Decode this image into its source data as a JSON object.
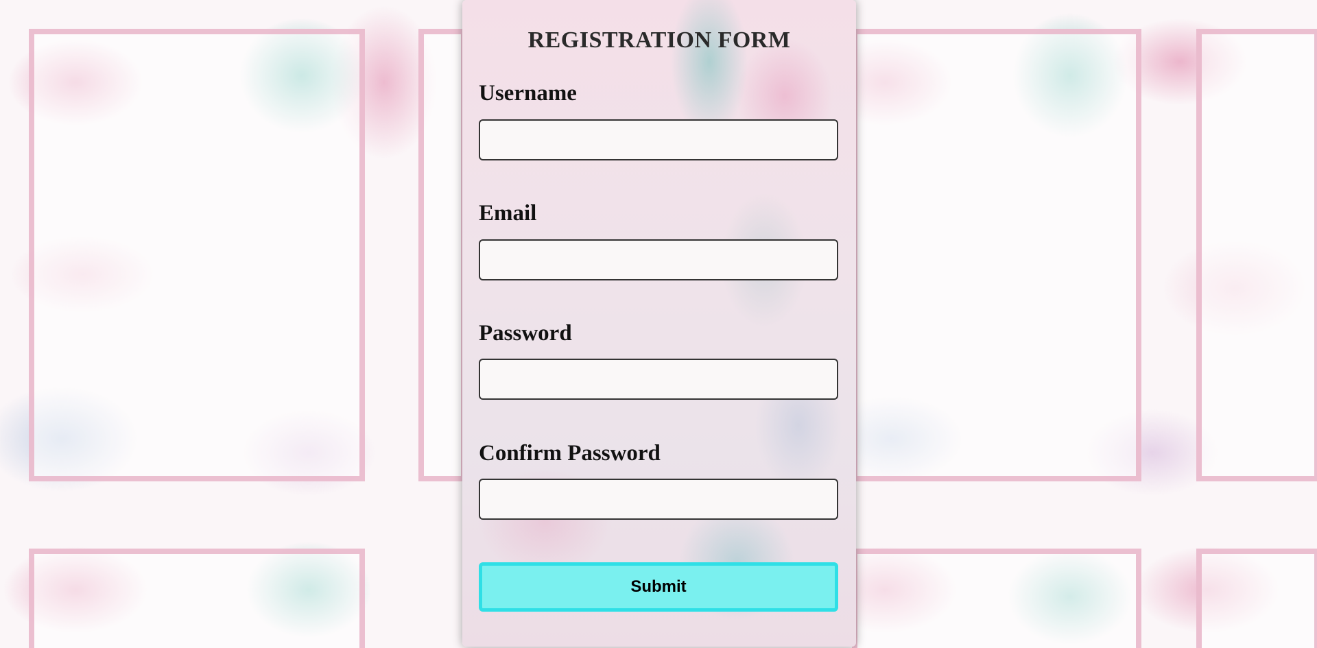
{
  "form": {
    "title": "REGISTRATION FORM",
    "fields": [
      {
        "label": "Username",
        "value": "",
        "placeholder": ""
      },
      {
        "label": "Email",
        "value": "",
        "placeholder": ""
      },
      {
        "label": "Password",
        "value": "",
        "placeholder": ""
      },
      {
        "label": "Confirm Password",
        "value": "",
        "placeholder": ""
      }
    ],
    "submit_label": "Submit"
  },
  "colors": {
    "panel_background": "#f0e3ea",
    "submit_fill": "#7af0ef",
    "submit_border": "#2fdfe6",
    "frame_border": "#e8b4c8",
    "input_background": "#faf8f8"
  }
}
